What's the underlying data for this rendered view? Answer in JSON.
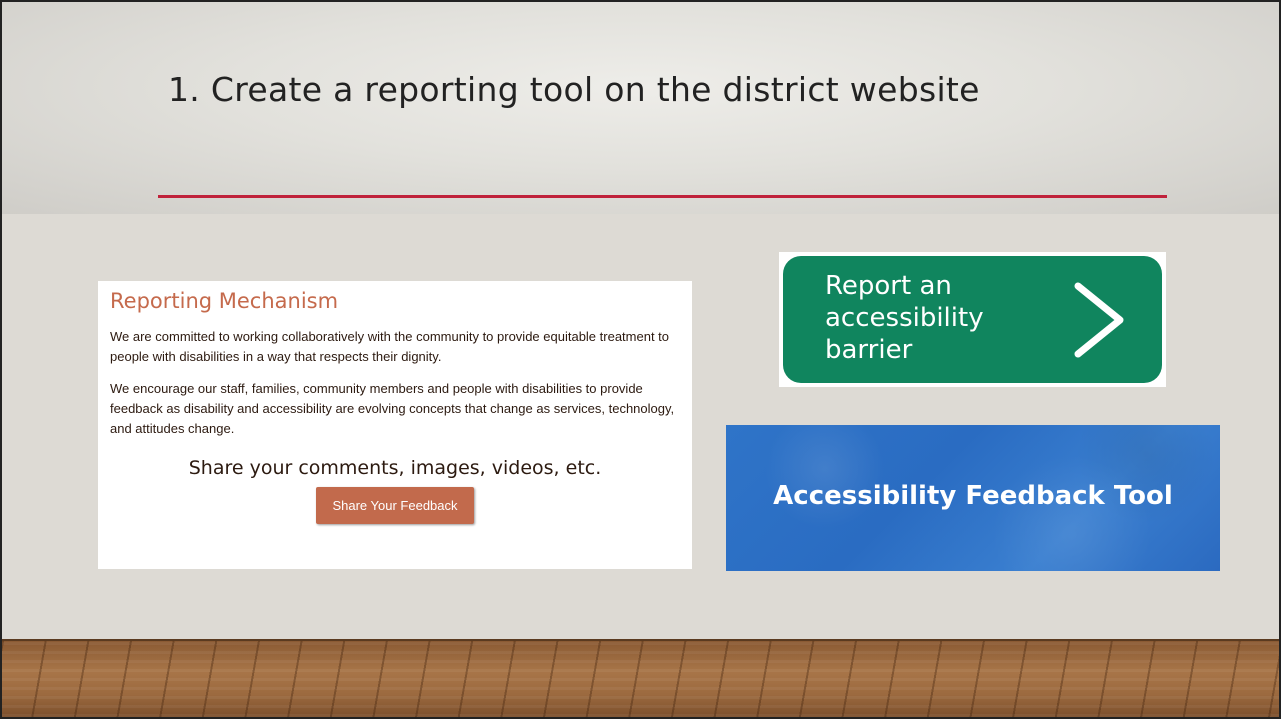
{
  "slide": {
    "title": "1. Create a reporting tool on the district website"
  },
  "reporting_panel": {
    "heading": "Reporting Mechanism",
    "paragraph_1": "We are committed to working collaboratively with the community to provide equitable treatment to people with disabilities in a way that respects their dignity.",
    "paragraph_2": "We encourage our staff, families, community members and people with disabilities to provide feedback as disability and accessibility are evolving concepts that change as services, technology, and attitudes change.",
    "share_prompt": "Share your comments, images, videos, etc.",
    "button_label": "Share Your Feedback"
  },
  "report_barrier_card": {
    "lines": [
      "Report an",
      "accessibility",
      "barrier"
    ],
    "icon": "chevron-right-icon",
    "color": "#10855e"
  },
  "feedback_tool_card": {
    "label": "Accessibility Feedback Tool",
    "color": "#2f74c8"
  },
  "colors": {
    "title_rule": "#c0223b",
    "heading": "#c56a4c",
    "button": "#c26a4c"
  }
}
